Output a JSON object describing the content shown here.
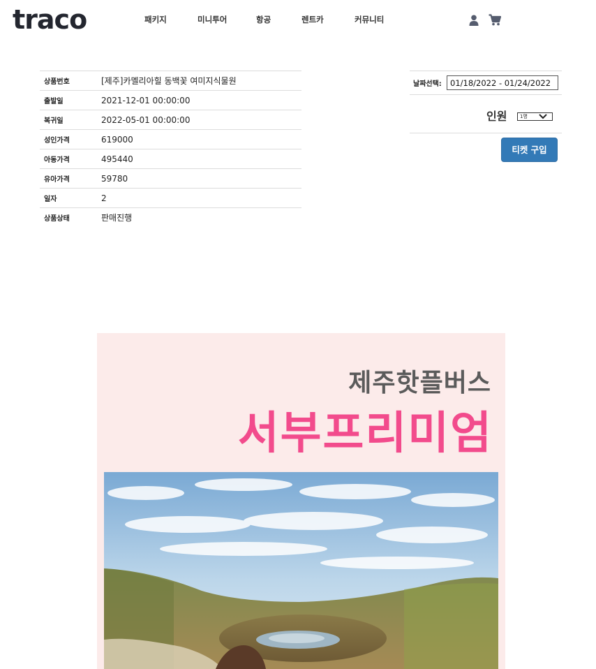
{
  "header": {
    "logo": "traco",
    "nav": [
      "패키지",
      "미니투어",
      "항공",
      "렌트카",
      "커뮤니티"
    ],
    "icons": [
      "user-icon",
      "cart-icon"
    ]
  },
  "product": {
    "rows": [
      {
        "label": "상품번호",
        "value": "[제주]카멜리아힐 동백꽃 여미지식물원"
      },
      {
        "label": "출발일",
        "value": "2021-12-01 00:00:00"
      },
      {
        "label": "복귀일",
        "value": "2022-05-01 00:00:00"
      },
      {
        "label": "성인가격",
        "value": "619000"
      },
      {
        "label": "아동가격",
        "value": "495440"
      },
      {
        "label": "유아가격",
        "value": "59780"
      },
      {
        "label": "일자",
        "value": "2"
      },
      {
        "label": "상품상태",
        "value": "판매진행"
      }
    ]
  },
  "booking": {
    "date_label": "날짜선택:",
    "date_value": "01/18/2022 - 01/24/2022",
    "people_label": "인원",
    "people_selected": "1명",
    "ticket_button": "티켓 구입"
  },
  "banner": {
    "subtitle": "제주핫플버스",
    "title": "서부프리미엄"
  },
  "colors": {
    "primary_button": "#337ab7",
    "banner_bg": "#fcebea",
    "banner_title": "#f24b8c",
    "logo": "#23262f"
  }
}
